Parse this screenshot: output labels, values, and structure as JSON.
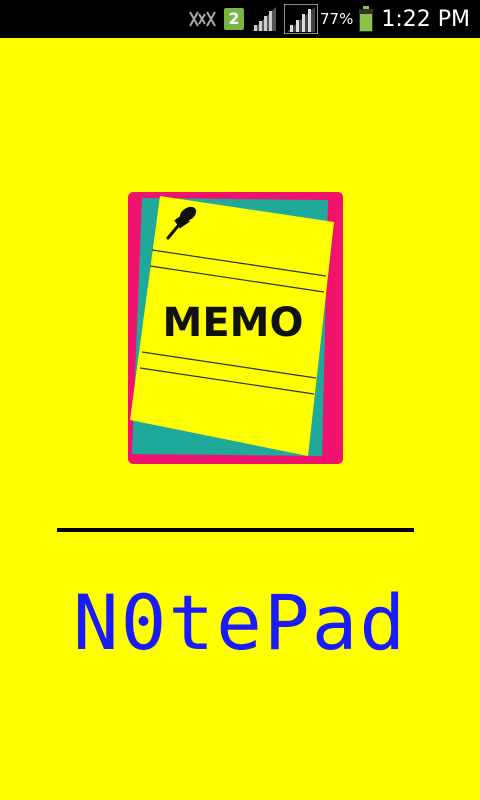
{
  "status_bar": {
    "notification_count": "2",
    "battery_percent": "77%",
    "time": "1:22 PM",
    "icons": [
      "no-sim-icon",
      "notification-badge",
      "signal-icon",
      "signal-icon-secondary",
      "battery-icon"
    ]
  },
  "logo": {
    "text": "MEMO",
    "colors": {
      "frame": "#f0136e",
      "back_sheet": "#1fa99a",
      "note": "#ffff00",
      "pin": "#111111"
    }
  },
  "app": {
    "title": "N0tePad"
  },
  "colors": {
    "background": "#ffff00",
    "title": "#1a1aff",
    "divider": "#000000"
  }
}
